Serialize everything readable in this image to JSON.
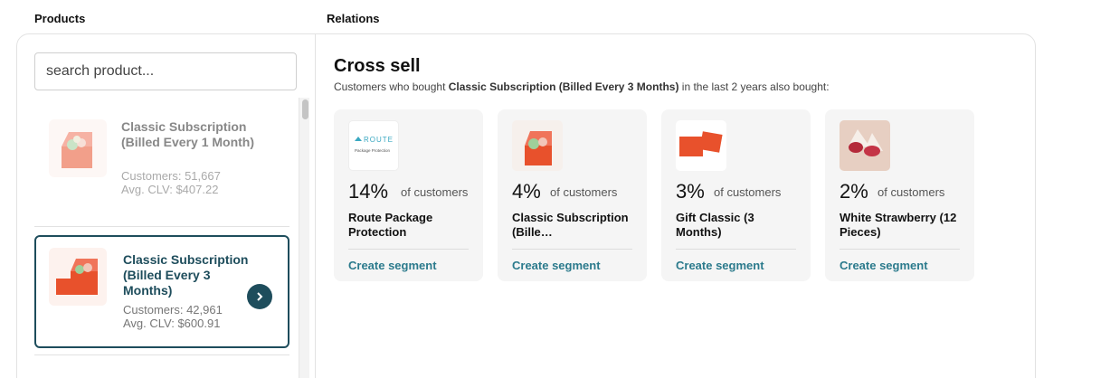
{
  "labels": {
    "products": "Products",
    "relations": "Relations"
  },
  "search": {
    "placeholder": "search product...",
    "value": ""
  },
  "products": [
    {
      "name": "Classic Subscription (Billed Every 1 Month)",
      "customers": "Customers: 51,667",
      "clv": "Avg. CLV: $407.22"
    },
    {
      "name": "Classic Subscription (Billed Every 3 Months)",
      "customers": "Customers: 42,961",
      "clv": "Avg. CLV: $600.91"
    }
  ],
  "relations": {
    "title": "Cross sell",
    "subtitle_prefix": "Customers who bought ",
    "subtitle_product": "Classic Subscription (Billed Every 3 Months)",
    "subtitle_suffix": " in the last 2 years also bought:",
    "cards": [
      {
        "pct": "14%",
        "pct_label": "of customers",
        "name": "Route Package Protection",
        "link": "Create segment",
        "logo_text": "ROUTE",
        "logo_sub": "Package Protection"
      },
      {
        "pct": "4%",
        "pct_label": "of customers",
        "name": "Classic Subscription (Bille…",
        "link": "Create segment"
      },
      {
        "pct": "3%",
        "pct_label": "of customers",
        "name": "Gift Classic (3 Months)",
        "link": "Create segment"
      },
      {
        "pct": "2%",
        "pct_label": "of customers",
        "name": "White Strawberry (12 Pieces)",
        "link": "Create segment"
      }
    ]
  },
  "colors": {
    "accent": "#1e4d5c",
    "link": "#2b7a8c",
    "card_bg": "#f5f5f5",
    "brand_orange": "#e8512c"
  }
}
